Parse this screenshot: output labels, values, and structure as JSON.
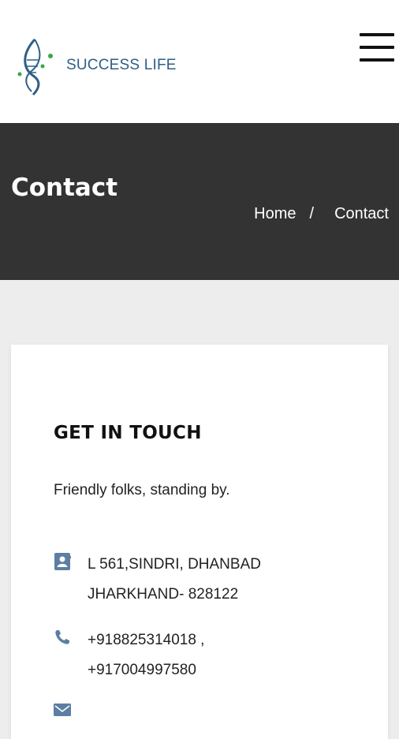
{
  "brand": {
    "name": "SUCCESS LIFE",
    "logo_colors": {
      "helix": "#2f5e86",
      "dots": "#3aa64a"
    }
  },
  "nav": {
    "menu_icon": "hamburger-menu-icon"
  },
  "hero": {
    "title": "Contact",
    "breadcrumb": {
      "home": "Home",
      "separator": "/",
      "current": "Contact"
    },
    "background": "#333333"
  },
  "contact": {
    "heading": "GET IN TOUCH",
    "subtitle": "Friendly folks, standing by.",
    "address": {
      "icon": "address-book-icon",
      "line1": "L 561,SINDRI, DHANBAD",
      "line2": "JHARKHAND- 828122"
    },
    "phone": {
      "icon": "phone-icon",
      "line1": "+918825314018 ,",
      "line2": "+917004997580"
    },
    "email": {
      "icon": "envelope-icon"
    },
    "icon_color": "#5d7ea3"
  }
}
